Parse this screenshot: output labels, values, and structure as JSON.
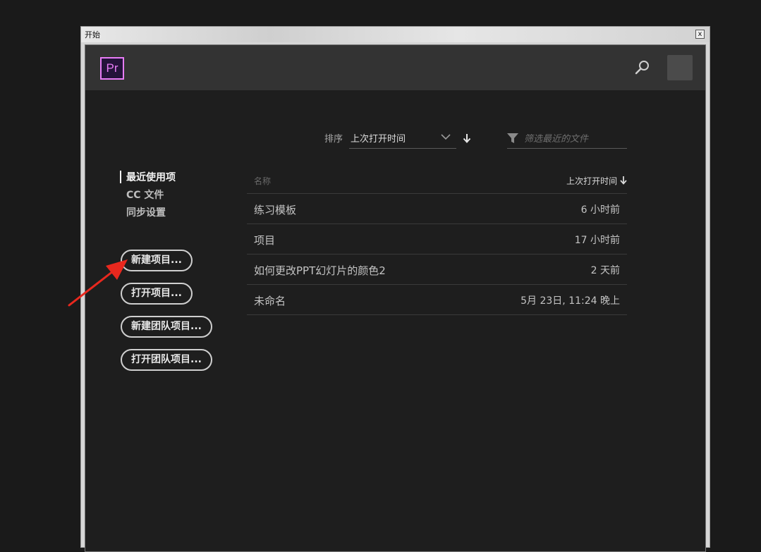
{
  "window": {
    "title": "开始",
    "close_glyph": "x"
  },
  "header": {
    "logo_text": "Pr",
    "search_icon": "search-icon",
    "avatar": "avatar-placeholder"
  },
  "sort": {
    "label": "排序",
    "selected": "上次打开时间",
    "dropdown_icon": "chevron-down-icon",
    "direction_icon": "arrow-down-icon"
  },
  "filter": {
    "placeholder": "筛选最近的文件",
    "icon": "funnel-icon"
  },
  "sidebar": {
    "items": [
      {
        "label": "最近使用项",
        "active": true
      },
      {
        "label": "CC 文件",
        "active": false
      },
      {
        "label": "同步设置",
        "active": false
      }
    ]
  },
  "actions": {
    "new_project": "新建项目...",
    "open_project": "打开项目...",
    "new_team_project": "新建团队项目...",
    "open_team_project": "打开团队项目..."
  },
  "table": {
    "col_name": "名称",
    "col_time": "上次打开时间",
    "rows": [
      {
        "name": "练习模板",
        "time": "6 小时前"
      },
      {
        "name": "项目",
        "time": "17 小时前"
      },
      {
        "name": "如何更改PPT幻灯片的颜色2",
        "time": "2 天前"
      },
      {
        "name": "未命名",
        "time": "5月 23日, 11:24 晚上"
      }
    ]
  },
  "colors": {
    "accent_pr": "#e77cf6",
    "annotation_arrow": "#e8281e",
    "panel_bg": "#1e1e1e",
    "header_bg": "#333333"
  }
}
